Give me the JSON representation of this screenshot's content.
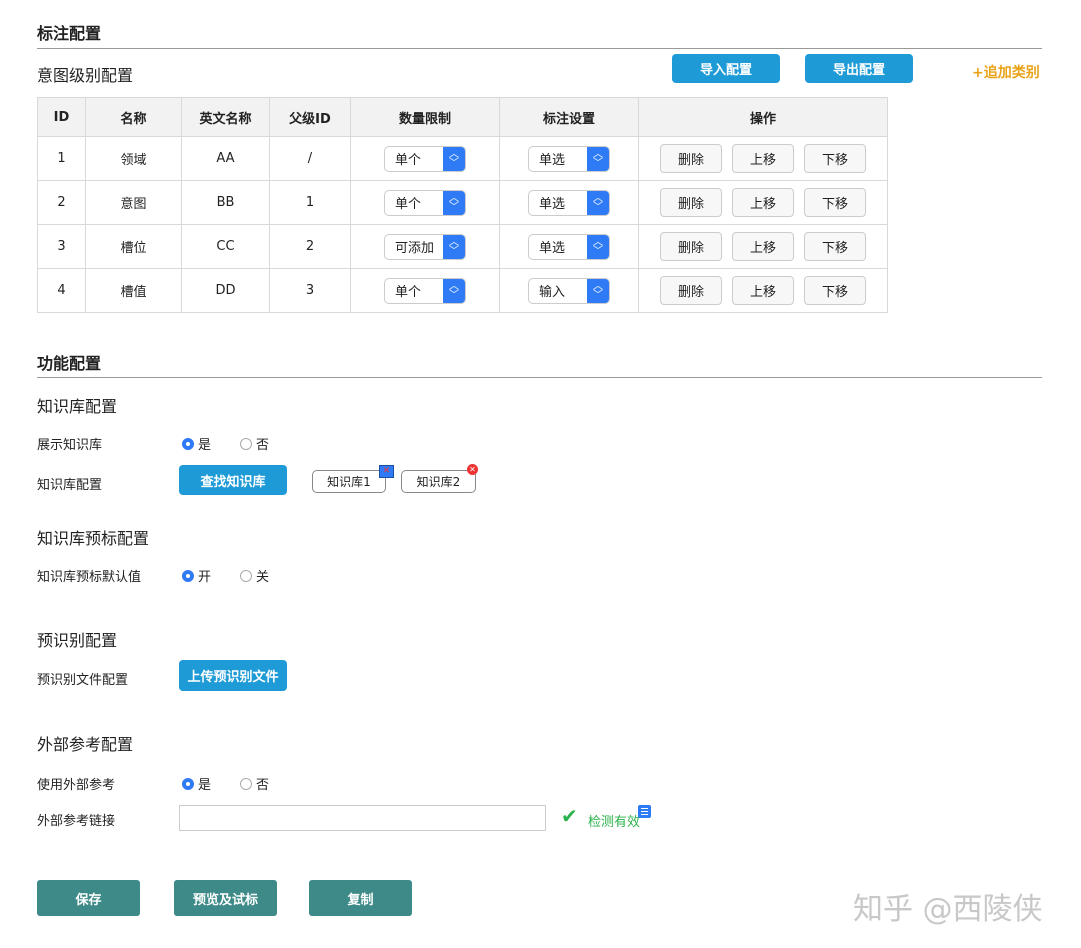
{
  "intent": {
    "section_title": "标注配置",
    "subtitle": "意图级别配置",
    "import_label": "导入配置",
    "export_label": "导出配置",
    "add_category_label": "+追加类别",
    "columns": [
      "ID",
      "名称",
      "英文名称",
      "父级ID",
      "数量限制",
      "标注设置",
      "操作"
    ],
    "rows": [
      {
        "id": "1",
        "name": "领域",
        "en": "AA",
        "parent": "/",
        "limit": "单个",
        "setting": "单选"
      },
      {
        "id": "2",
        "name": "意图",
        "en": "BB",
        "parent": "1",
        "limit": "单个",
        "setting": "单选"
      },
      {
        "id": "3",
        "name": "槽位",
        "en": "CC",
        "parent": "2",
        "limit": "可添加",
        "setting": "单选"
      },
      {
        "id": "4",
        "name": "槽值",
        "en": "DD",
        "parent": "3",
        "limit": "单个",
        "setting": "输入"
      }
    ],
    "actions": {
      "delete": "删除",
      "up": "上移",
      "down": "下移"
    }
  },
  "feature": {
    "section_title": "功能配置",
    "kb": {
      "title": "知识库配置",
      "show_label": "展示知识库",
      "yes": "是",
      "no": "否",
      "config_label": "知识库配置",
      "find_button": "查找知识库",
      "tags": [
        "知识库1",
        "知识库2"
      ]
    },
    "kb_pre": {
      "title": "知识库预标配置",
      "default_label": "知识库预标默认值",
      "on": "开",
      "off": "关"
    },
    "pre_recog": {
      "title": "预识别配置",
      "file_label": "预识别文件配置",
      "upload_button": "上传预识别文件"
    },
    "external": {
      "title": "外部参考配置",
      "use_label": "使用外部参考",
      "yes": "是",
      "no": "否",
      "link_label": "外部参考链接",
      "link_value": "",
      "valid_text": "检测有效"
    }
  },
  "footer": {
    "save": "保存",
    "preview": "预览及试标",
    "copy": "复制"
  },
  "watermark": "知乎 @西陵侠",
  "colors": {
    "primary": "#1e9bd7",
    "teal": "#3d8a88",
    "accent": "#e8a317",
    "select": "#2f7bf5",
    "valid": "#2bb24c"
  }
}
